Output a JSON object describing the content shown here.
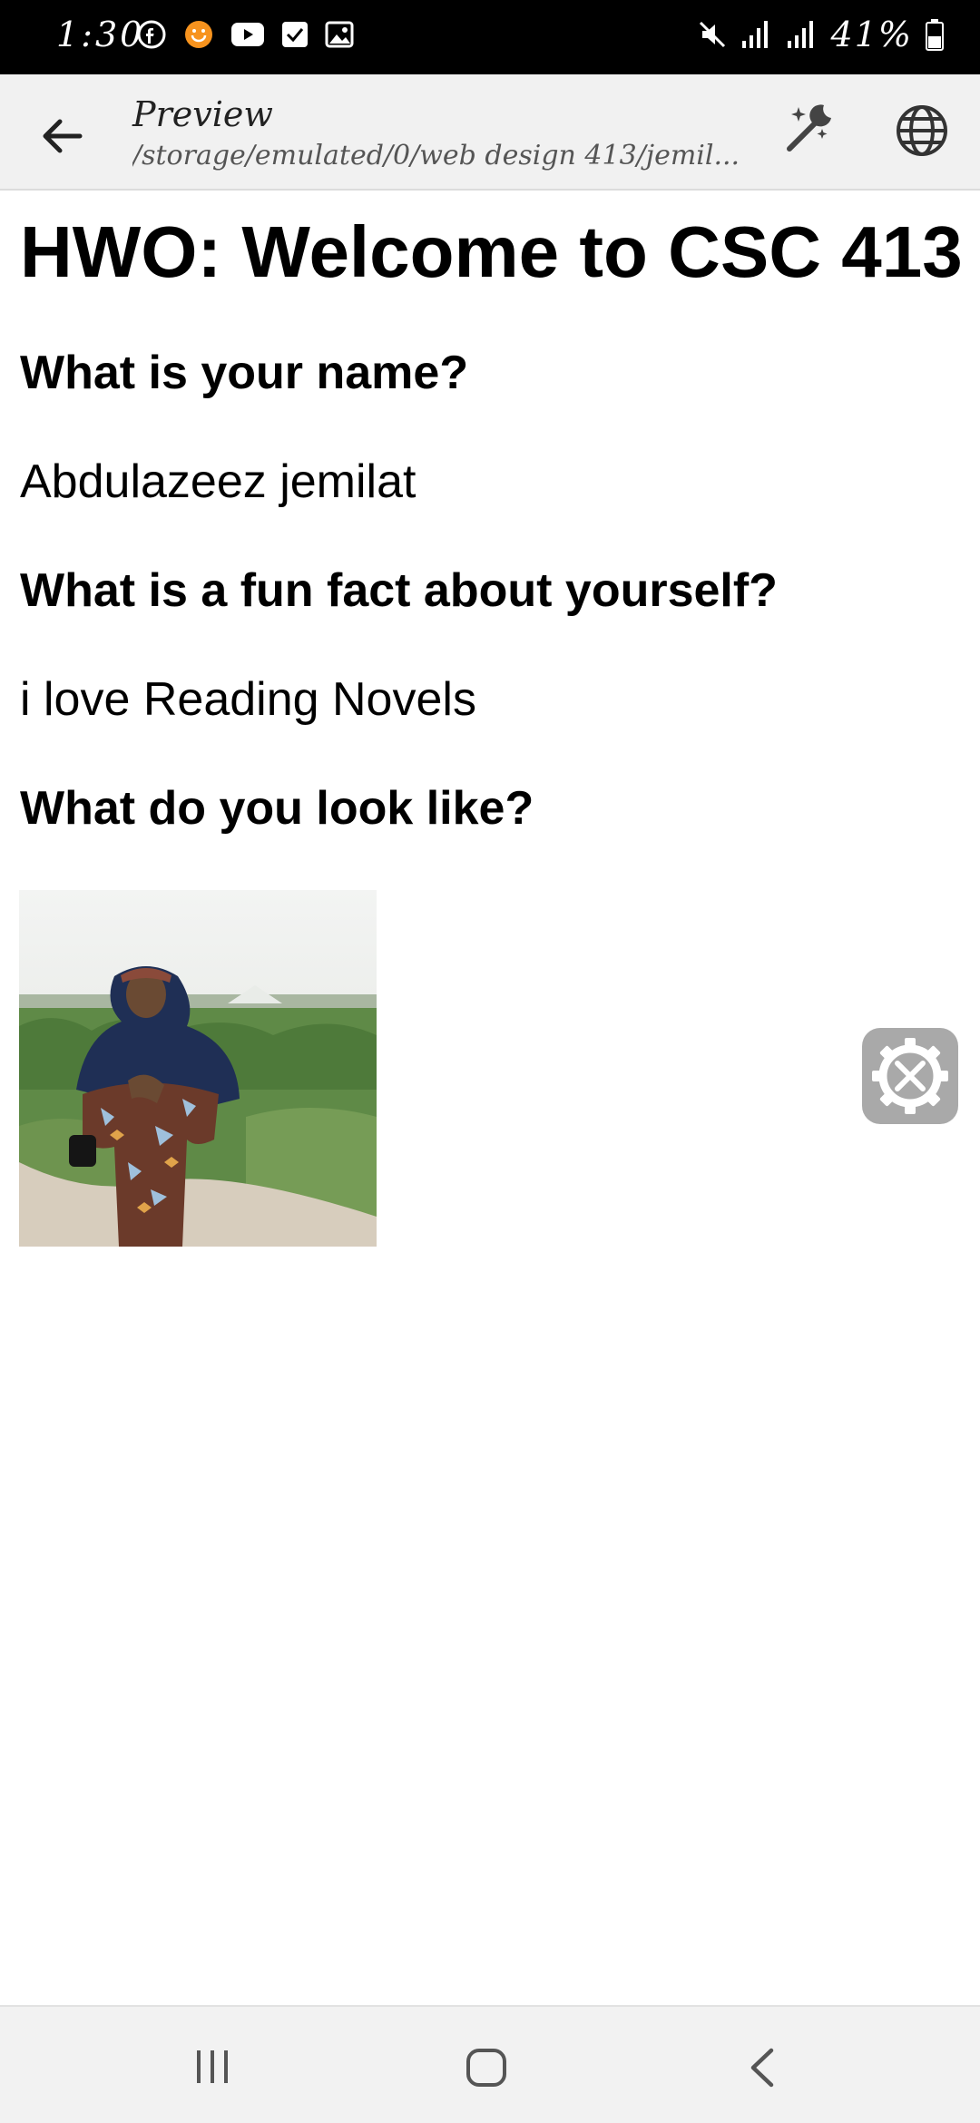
{
  "status": {
    "time": "1:30",
    "battery": "41%"
  },
  "appbar": {
    "title": "Preview",
    "subtitle": "/storage/emulated/0/web design 413/jemil..."
  },
  "page": {
    "title": "HWO: Welcome to CSC 413",
    "q_name": "What is your name?",
    "a_name": "Abdulazeez jemilat",
    "q_fact": "What is a fun fact about yourself?",
    "a_fact": "i love Reading Novels",
    "q_look": "What do you look like?"
  },
  "icons": {
    "back": "arrow-left-icon",
    "magic": "magic-wand-icon",
    "globe": "globe-icon",
    "tools": "tools-gear-icon"
  }
}
